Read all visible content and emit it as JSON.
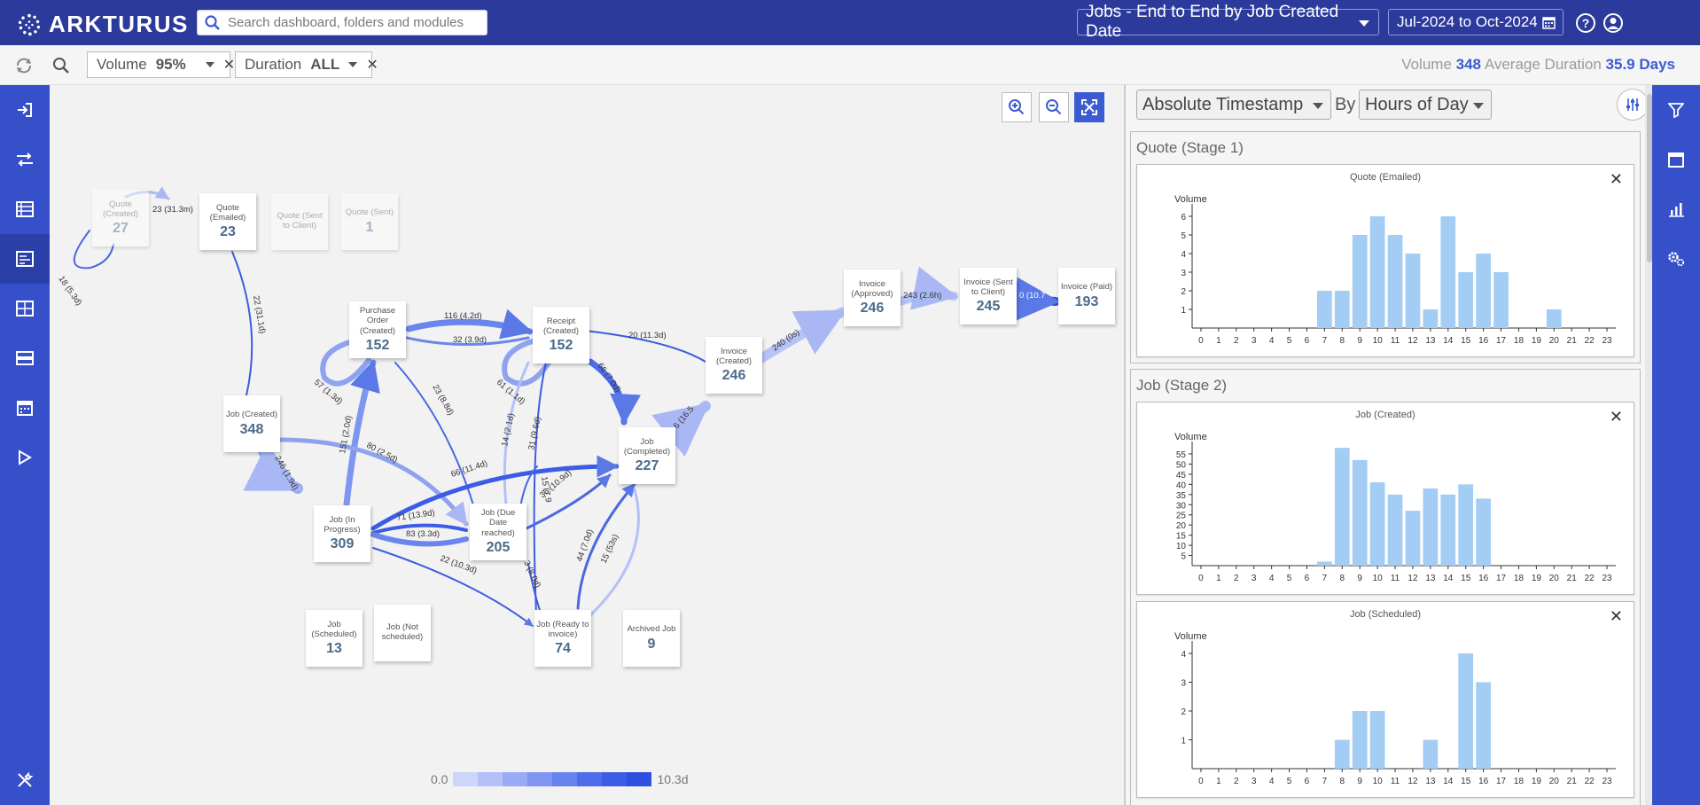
{
  "app": {
    "logo_text": "ARKTURUS"
  },
  "search": {
    "placeholder": "Search dashboard, folders and modules"
  },
  "header": {
    "view_selector": "Jobs - End to End by Job Created Date",
    "date_range": "Jul-2024 to Oct-2024"
  },
  "filters": [
    {
      "label": "Volume",
      "value": "95%"
    },
    {
      "label": "Duration",
      "value": "ALL"
    }
  ],
  "stats": {
    "volume_label": "Volume",
    "volume_value": "348",
    "duration_label": "Average Duration",
    "duration_value": "35.9 Days"
  },
  "process_map": {
    "nodes": [
      {
        "id": "quote_created",
        "label": "Quote (Created)",
        "value": "27",
        "faded": true
      },
      {
        "id": "quote_emailed",
        "label": "Quote (Emailed)",
        "value": "23"
      },
      {
        "id": "quote_sent_client",
        "label": "Quote (Sent to Client)",
        "value": "",
        "faded": true
      },
      {
        "id": "quote_sent",
        "label": "Quote (Sent)",
        "value": "1",
        "faded": true
      },
      {
        "id": "po_created",
        "label": "Purchase Order (Created)",
        "value": "152"
      },
      {
        "id": "receipt_created",
        "label": "Receipt (Created)",
        "value": "152"
      },
      {
        "id": "invoice_created",
        "label": "Invoice (Created)",
        "value": "246"
      },
      {
        "id": "invoice_approved",
        "label": "Invoice (Approved)",
        "value": "246"
      },
      {
        "id": "invoice_sent_client",
        "label": "Invoice (Sent to Client)",
        "value": "245"
      },
      {
        "id": "invoice_paid",
        "label": "Invoice (Paid)",
        "value": "193"
      },
      {
        "id": "job_created",
        "label": "Job (Created)",
        "value": "348"
      },
      {
        "id": "job_completed",
        "label": "Job (Completed)",
        "value": "227"
      },
      {
        "id": "job_in_progress",
        "label": "Job (In Progress)",
        "value": "309"
      },
      {
        "id": "job_due_date",
        "label": "Job (Due Date reached)",
        "value": "205"
      },
      {
        "id": "job_scheduled",
        "label": "Job (Scheduled)",
        "value": "13"
      },
      {
        "id": "job_not_scheduled",
        "label": "Job (Not scheduled)",
        "value": ""
      },
      {
        "id": "job_ready_invoice",
        "label": "Job (Ready to invoice)",
        "value": "74"
      },
      {
        "id": "archived_job",
        "label": "Archived Job",
        "value": "9"
      }
    ],
    "edge_labels": [
      "23 (31.3m)",
      "18 (5.3d)",
      "22 (31.1d)",
      "116 (4.2d)",
      "32 (3.9d)",
      "20 (11.3d)",
      "240 (0s)",
      "243 (2.6h)",
      "0 (10.7",
      "57 (1.3d)",
      "61 (1.1d)",
      "66 (7.0d)",
      "23 (8.8d)",
      "6 (16.5",
      "151 (2.0d)",
      "80 (2.5d)",
      "14 (2.1d)",
      "31 (9.6d)",
      "246 (1.9d)",
      "66 (11.4d)",
      "15 (7.9",
      "36 (10.9d)",
      "71 (13.9d)",
      "83 (3.3d)",
      "22 (10.3d)",
      "3 (8.0d)",
      "44 (7.0d)",
      "15 (53s)"
    ],
    "legend": {
      "min": "0.0",
      "max": "10.3d",
      "colors": [
        "#cdd5fa",
        "#b4c0f8",
        "#9aabf5",
        "#8096f2",
        "#6882ee",
        "#4f6deb",
        "#3c5ce6",
        "#2f4fe0"
      ]
    }
  },
  "panel": {
    "timestamp_select": "Absolute Timestamp",
    "by_label": "By",
    "group_select": "Hours of Day",
    "stages": [
      {
        "title": "Quote (Stage 1)",
        "cards": [
          {
            "title": "Quote (Emailed)",
            "ylabel": "Volume",
            "yticks": [
              1,
              2,
              3,
              4,
              5,
              6
            ],
            "ymax": 6,
            "values": [
              0,
              0,
              0,
              0,
              0,
              0,
              0,
              2,
              2,
              5,
              6,
              5,
              4,
              1,
              6,
              3,
              4,
              3,
              0,
              0,
              1,
              0,
              0,
              0
            ]
          }
        ]
      },
      {
        "title": "Job (Stage 2)",
        "cards": [
          {
            "title": "Job (Created)",
            "ylabel": "Volume",
            "yticks": [
              5,
              10,
              15,
              20,
              25,
              30,
              35,
              40,
              45,
              50,
              55
            ],
            "ymax": 55,
            "values": [
              0,
              0,
              0,
              0,
              0,
              0,
              0,
              2,
              58,
              52,
              41,
              35,
              27,
              38,
              35,
              40,
              33,
              0,
              0,
              0,
              0,
              0,
              0,
              0
            ]
          },
          {
            "title": "Job (Scheduled)",
            "ylabel": "Volume",
            "yticks": [
              1,
              2,
              3,
              4
            ],
            "ymax": 4,
            "values": [
              0,
              0,
              0,
              0,
              0,
              0,
              0,
              0,
              1,
              2,
              2,
              0,
              0,
              1,
              0,
              4,
              3,
              0,
              0,
              0,
              0,
              0,
              0,
              0
            ]
          }
        ]
      }
    ],
    "xticks": [
      "0",
      "1",
      "2",
      "3",
      "4",
      "5",
      "6",
      "7",
      "8",
      "9",
      "10",
      "11",
      "12",
      "13",
      "14",
      "15",
      "16",
      "17",
      "18",
      "19",
      "20",
      "21",
      "22",
      "23"
    ]
  }
}
